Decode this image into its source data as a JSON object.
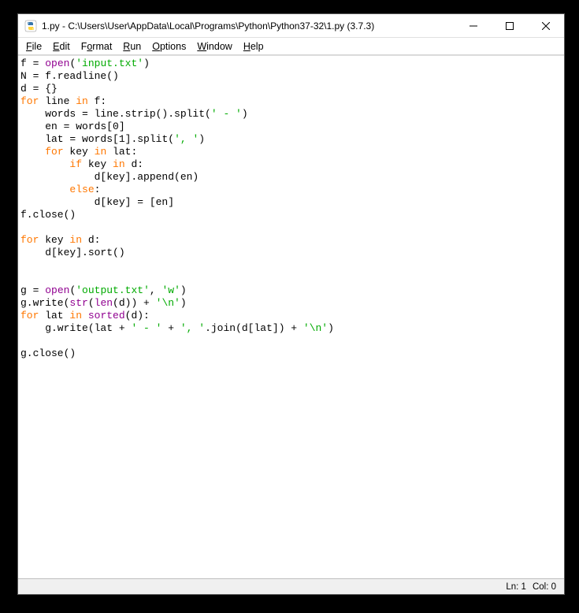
{
  "window": {
    "title": "1.py - C:\\Users\\User\\AppData\\Local\\Programs\\Python\\Python37-32\\1.py (3.7.3)"
  },
  "menu": {
    "file": {
      "underline": "F",
      "rest": "ile"
    },
    "edit": {
      "underline": "E",
      "rest": "dit"
    },
    "format": {
      "underline": "o",
      "pre": "F",
      "rest": "rmat"
    },
    "run": {
      "underline": "R",
      "rest": "un"
    },
    "options": {
      "underline": "O",
      "rest": "ptions"
    },
    "window": {
      "underline": "W",
      "rest": "indow"
    },
    "help": {
      "underline": "H",
      "rest": "elp"
    }
  },
  "code": {
    "l1": {
      "a": "f = ",
      "b": "open",
      "c": "(",
      "d": "'input.txt'",
      "e": ")"
    },
    "l2": "N = f.readline()",
    "l3": "d = {}",
    "l4": {
      "a": "for",
      "b": " line ",
      "c": "in",
      "d": " f:"
    },
    "l5": {
      "a": "    words = line.strip().split(",
      "b": "' - '",
      "c": ")"
    },
    "l6": {
      "a": "    en = words[",
      "b": "0",
      "c": "]"
    },
    "l7": {
      "a": "    lat = words[",
      "b": "1",
      "c": "].split(",
      "d": "', '",
      "e": ")"
    },
    "l8": {
      "a": "    ",
      "b": "for",
      "c": " key ",
      "d": "in",
      "e": " lat:"
    },
    "l9": {
      "a": "        ",
      "b": "if",
      "c": " key ",
      "d": "in",
      "e": " d:"
    },
    "l10": "            d[key].append(en)",
    "l11": {
      "a": "        ",
      "b": "else",
      "c": ":"
    },
    "l12": "            d[key] = [en]",
    "l13": "f.close()",
    "l14": "",
    "l15": {
      "a": "for",
      "b": " key ",
      "c": "in",
      "d": " d:"
    },
    "l16": "    d[key].sort()",
    "l17": "",
    "l18": "",
    "l19": {
      "a": "g = ",
      "b": "open",
      "c": "(",
      "d": "'output.txt'",
      "e": ", ",
      "f": "'w'",
      "g": ")"
    },
    "l20": {
      "a": "g.write(",
      "b": "str",
      "c": "(",
      "d": "len",
      "e": "(d)) + ",
      "f": "'\\n'",
      "g": ")"
    },
    "l21": {
      "a": "for",
      "b": " lat ",
      "c": "in",
      "d": " ",
      "e": "sorted",
      "f": "(d):"
    },
    "l22": {
      "a": "    g.write(lat + ",
      "b": "' - '",
      "c": " + ",
      "d": "', '",
      "e": ".join(d[lat]) + ",
      "f": "'\\n'",
      "g": ")"
    },
    "l23": "",
    "l24": "g.close()"
  },
  "status": {
    "ln": "Ln: 1",
    "col": "Col: 0"
  }
}
